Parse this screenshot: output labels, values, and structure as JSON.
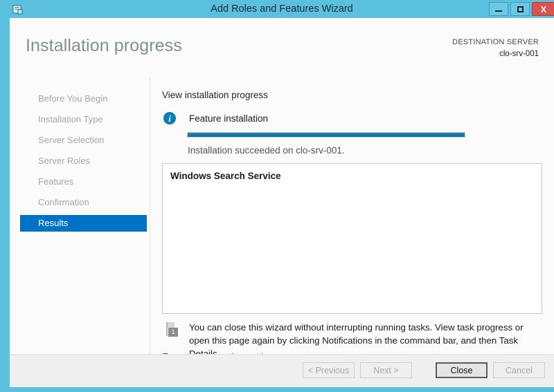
{
  "window": {
    "title": "Add Roles and Features Wizard",
    "icon": "wizard-icon",
    "controls": {
      "minimize": "–",
      "maximize": "□",
      "close": "X"
    },
    "accent_color": "#5bc0de"
  },
  "header": {
    "page_title": "Installation progress",
    "destination_label": "DESTINATION SERVER",
    "destination_server": "clo-srv-001"
  },
  "sidebar": {
    "items": [
      {
        "label": "Before You Begin",
        "active": false
      },
      {
        "label": "Installation Type",
        "active": false
      },
      {
        "label": "Server Selection",
        "active": false
      },
      {
        "label": "Server Roles",
        "active": false
      },
      {
        "label": "Features",
        "active": false
      },
      {
        "label": "Confirmation",
        "active": false
      },
      {
        "label": "Results",
        "active": true
      }
    ],
    "active_color": "#0072c6"
  },
  "content": {
    "heading": "View installation progress",
    "status_icon": "info-icon",
    "status_title": "Feature installation",
    "progress": {
      "percent": 100,
      "fill_color": "#1a7fab"
    },
    "progress_message": "Installation succeeded on clo-srv-001.",
    "results": [
      "Windows Search Service"
    ],
    "note_icon": "notification-flag-icon",
    "note_badge": "1",
    "note_text": "You can close this wizard without interrupting running tasks. View task progress or open this page again by clicking Notifications in the command bar, and then Task Details.",
    "export_link": "Export configuration settings",
    "link_color": "#0f6fc6"
  },
  "footer": {
    "buttons": [
      {
        "label": "< Previous",
        "state": "disabled"
      },
      {
        "label": "Next >",
        "state": "disabled"
      },
      {
        "label": "Close",
        "state": "default"
      },
      {
        "label": "Cancel",
        "state": "disabled"
      }
    ]
  }
}
